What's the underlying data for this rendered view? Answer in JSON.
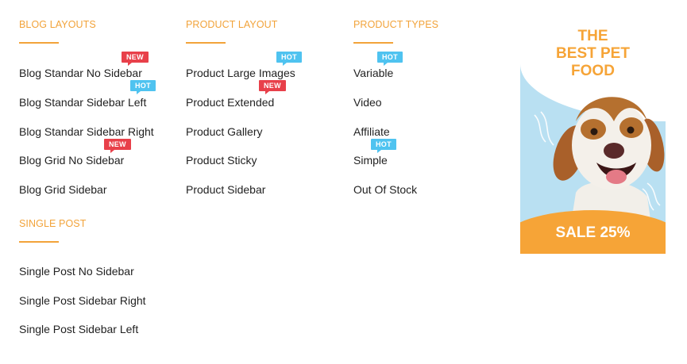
{
  "menu": {
    "columns": [
      {
        "heading": "BLOG LAYOUTS",
        "items": [
          {
            "label": "Blog Standar No Sidebar",
            "badge": "NEW"
          },
          {
            "label": "Blog Standar Sidebar Left",
            "badge": "HOT"
          },
          {
            "label": "Blog Standar Sidebar Right"
          },
          {
            "label": "Blog Grid No Sidebar",
            "badge": "NEW"
          },
          {
            "label": "Blog Grid Sidebar"
          }
        ]
      },
      {
        "heading": "PRODUCT LAYOUT",
        "items": [
          {
            "label": "Product Large Images",
            "badge": "HOT"
          },
          {
            "label": "Product Extended",
            "badge": "NEW"
          },
          {
            "label": "Product Gallery"
          },
          {
            "label": "Product Sticky"
          },
          {
            "label": "Product Sidebar"
          }
        ]
      },
      {
        "heading": "PRODUCT TYPES",
        "items": [
          {
            "label": "Variable",
            "badge": "HOT"
          },
          {
            "label": "Video"
          },
          {
            "label": "Affiliate"
          },
          {
            "label": "Simple",
            "badge": "HOT"
          },
          {
            "label": "Out Of Stock"
          }
        ]
      }
    ],
    "single_post": {
      "heading": "SINGLE POST",
      "items": [
        {
          "label": "Single Post No Sidebar"
        },
        {
          "label": "Single Post Sidebar Right"
        },
        {
          "label": "Single Post Sidebar Left"
        }
      ]
    }
  },
  "banner": {
    "title_line1": "THE",
    "title_line2": "BEST PET",
    "title_line3": "FOOD",
    "sale": "SALE 25%"
  },
  "colors": {
    "accent": "#f2a33a",
    "badge_new": "#e8404a",
    "badge_hot": "#4fc3f0",
    "banner_bg": "#b9e0f2"
  }
}
